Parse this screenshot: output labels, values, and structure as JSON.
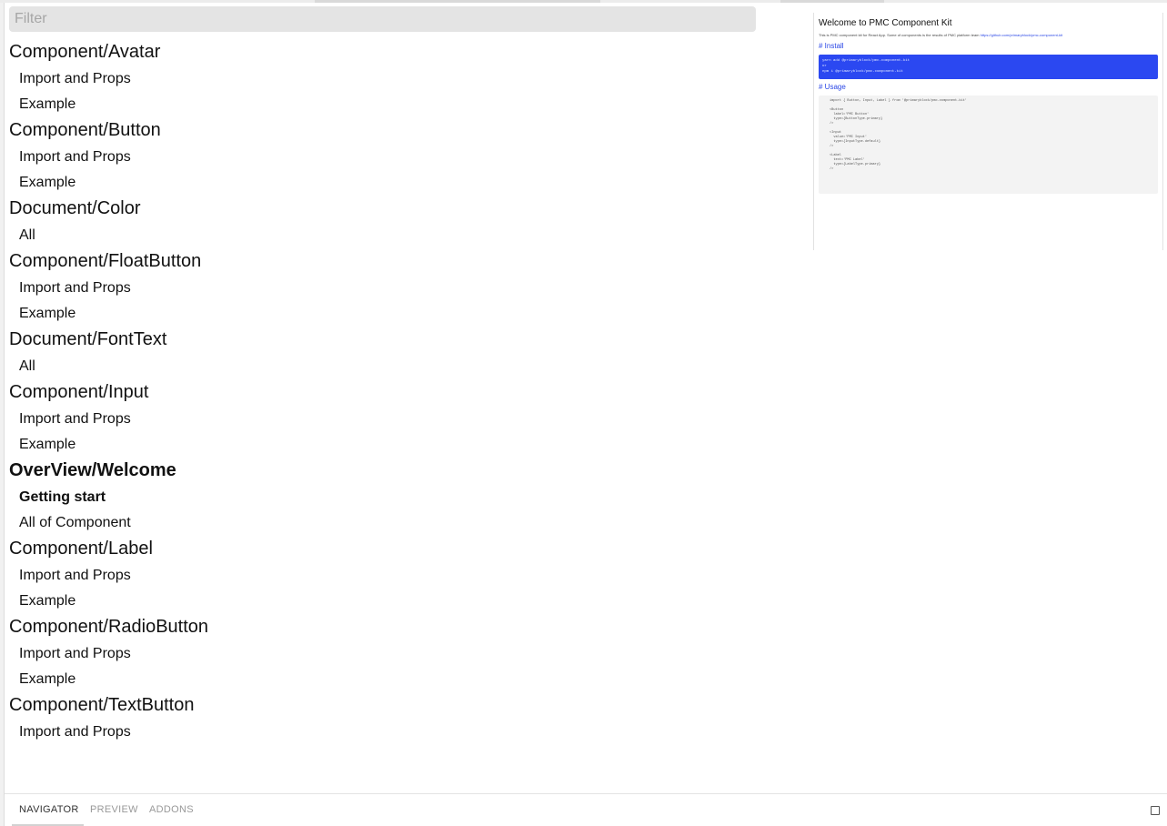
{
  "filter": {
    "placeholder": "Filter",
    "value": ""
  },
  "groups": [
    {
      "title": "Component/Avatar",
      "stories": [
        "Import and Props",
        "Example"
      ]
    },
    {
      "title": "Component/Button",
      "stories": [
        "Import and Props",
        "Example"
      ]
    },
    {
      "title": "Document/Color",
      "stories": [
        "All"
      ]
    },
    {
      "title": "Component/FloatButton",
      "stories": [
        "Import and Props",
        "Example"
      ]
    },
    {
      "title": "Document/FontText",
      "stories": [
        "All"
      ]
    },
    {
      "title": "Component/Input",
      "stories": [
        "Import and Props",
        "Example"
      ]
    },
    {
      "title": "OverView/Welcome",
      "stories": [
        "Getting start",
        "All of Component"
      ],
      "selected": true,
      "active_story": 0
    },
    {
      "title": "Component/Label",
      "stories": [
        "Import and Props",
        "Example"
      ]
    },
    {
      "title": "Component/RadioButton",
      "stories": [
        "Import and Props",
        "Example"
      ]
    },
    {
      "title": "Component/TextButton",
      "stories": [
        "Import and Props"
      ]
    }
  ],
  "preview": {
    "title": "Welcome to PMC Component Kit",
    "intro": "This is PMC component kit for React App. Some of components is the results of PMC platform team ",
    "intro_link": "https://github.com/primaryblock/pmc-component-kit",
    "install_heading": "# Install",
    "install_lines": [
      "yarn add @primaryblock/pmc-component-kit",
      "or",
      "npm i @primaryblock/pmc-component-kit"
    ],
    "usage_heading": "# Usage",
    "usage_lines": [
      "import { Button, Input, Label } from '@primaryblock/pmc-component-kit'",
      "",
      "<Button",
      "  label='PMC Button'",
      "  type={ButtonType.primary}",
      "/>",
      "",
      "<Input",
      "  value='PMC Input'",
      "  type={InputType.default}",
      "/>",
      "",
      "<Label",
      "  text='PMC Label'",
      "  type={LabelType.primary}",
      "/>"
    ]
  },
  "bottom_tabs": [
    "NAVIGATOR",
    "PREVIEW",
    "ADDONS"
  ],
  "active_tab": 0,
  "colors": {
    "accent": "#2b48f1",
    "filter_bg": "#e4e4e4",
    "tab_active": "#333333",
    "tab_inactive": "#999999"
  }
}
